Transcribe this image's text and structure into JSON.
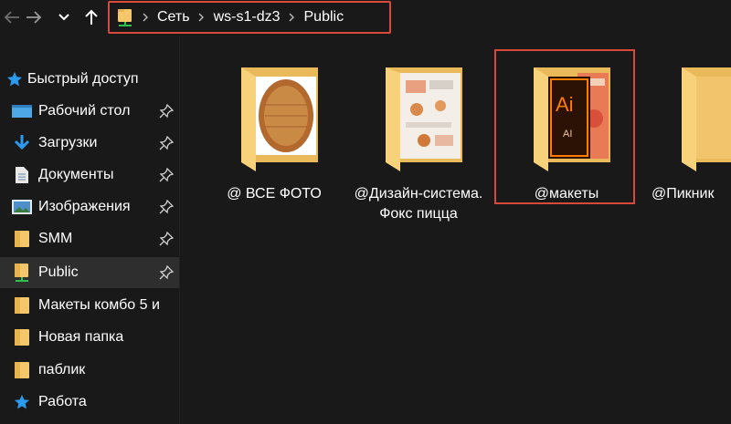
{
  "toolbar": {
    "back": "back",
    "forward": "forward",
    "recent": "recent-locations",
    "up": "up"
  },
  "breadcrumb": [
    "Сеть",
    "ws-s1-dz3",
    "Public"
  ],
  "sidebar": {
    "quick_access": "Быстрый доступ",
    "items": [
      {
        "label": "Рабочий стол",
        "icon": "desktop-icon",
        "pinned": true
      },
      {
        "label": "Загрузки",
        "icon": "download-icon",
        "pinned": true
      },
      {
        "label": "Документы",
        "icon": "document-icon",
        "pinned": true
      },
      {
        "label": "Изображения",
        "icon": "pictures-icon",
        "pinned": true
      },
      {
        "label": "SMM",
        "icon": "folder-icon",
        "pinned": true
      },
      {
        "label": "Public",
        "icon": "network-folder-icon",
        "pinned": true
      },
      {
        "label": "Макеты комбо 5 и",
        "icon": "folder-icon",
        "pinned": false
      },
      {
        "label": "Новая папка",
        "icon": "folder-icon",
        "pinned": false
      },
      {
        "label": "паблик",
        "icon": "folder-icon",
        "pinned": false
      },
      {
        "label": "Работа",
        "icon": "star-icon",
        "pinned": false
      }
    ]
  },
  "folders": [
    {
      "name": "@ ВСЕ ФОТО"
    },
    {
      "name": "@Дизайн-система. Фокс пицца"
    },
    {
      "name": "@макеты"
    },
    {
      "name": "@Пикник"
    }
  ],
  "colors": {
    "background": "#191919",
    "selection_border": "#d9493a",
    "folder": "#f5c76a",
    "accent_blue": "#2b9bf0"
  }
}
